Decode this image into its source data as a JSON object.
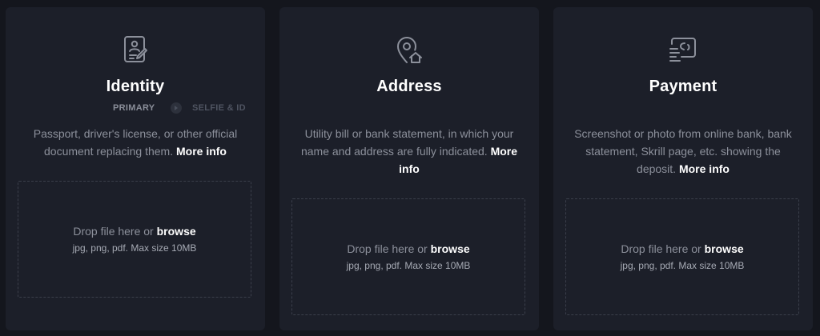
{
  "cards": [
    {
      "icon": "id-document-icon",
      "title": "Identity",
      "subtabs": {
        "primary": "PRIMARY",
        "secondary": "SELFIE & ID"
      },
      "description": "Passport, driver's license, or other official document replacing them.",
      "more_info": "More info",
      "drop": {
        "prefix": "Drop file here or",
        "browse": "browse",
        "hint": "jpg, png, pdf. Max size 10MB"
      }
    },
    {
      "icon": "home-location-pin-icon",
      "title": "Address",
      "description": "Utility bill or bank statement, in which your name and address are fully indicated.",
      "more_info": "More info",
      "drop": {
        "prefix": "Drop file here or",
        "browse": "browse",
        "hint": "jpg, png, pdf. Max size 10MB"
      }
    },
    {
      "icon": "payment-card-icon",
      "title": "Payment",
      "description": "Screenshot or photo from online bank, bank statement, Skrill page, etc. showing the deposit.",
      "more_info": "More info",
      "drop": {
        "prefix": "Drop file here or",
        "browse": "browse",
        "hint": "jpg, png, pdf. Max size 10MB"
      }
    }
  ],
  "colors": {
    "background": "#14161d",
    "card": "#1c1f29",
    "text_muted": "#8c909b",
    "text_strong": "#ffffff",
    "icon": "#8c909b",
    "dashed_border": "#3b3f4b"
  }
}
